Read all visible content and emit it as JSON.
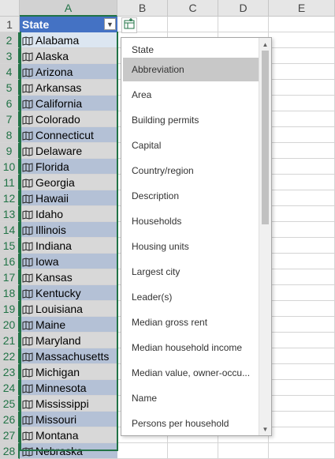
{
  "columns": [
    "A",
    "B",
    "C",
    "D",
    "E"
  ],
  "rows": [
    "1",
    "2",
    "3",
    "4",
    "5",
    "6",
    "7",
    "8",
    "9",
    "10",
    "11",
    "12",
    "13",
    "14",
    "15",
    "16",
    "17",
    "18",
    "19",
    "20",
    "21",
    "22",
    "23",
    "24",
    "25",
    "26",
    "27",
    "28"
  ],
  "header_cell": "State",
  "states": [
    "Alabama",
    "Alaska",
    "Arizona",
    "Arkansas",
    "California",
    "Colorado",
    "Connecticut",
    "Delaware",
    "Florida",
    "Georgia",
    "Hawaii",
    "Idaho",
    "Illinois",
    "Indiana",
    "Iowa",
    "Kansas",
    "Kentucky",
    "Louisiana",
    "Maine",
    "Maryland",
    "Massachusetts",
    "Michigan",
    "Minnesota",
    "Mississippi",
    "Missouri",
    "Montana",
    "Nebraska"
  ],
  "dropdown": {
    "title": "State",
    "items": [
      "Abbreviation",
      "Area",
      "Building permits",
      "Capital",
      "Country/region",
      "Description",
      "Households",
      "Housing units",
      "Largest city",
      "Leader(s)",
      "Median gross rent",
      "Median household income",
      "Median value, owner-occu...",
      "Name",
      "Persons per household"
    ],
    "highlighted_index": 0
  },
  "icons": {
    "filter": "dropdown-arrow-icon",
    "insert_data": "insert-data-icon",
    "geography": "map-icon"
  },
  "colors": {
    "header_fill": "#4472c4",
    "band_odd": "#b4c1d6",
    "band_even": "#d8d8d8",
    "selection": "#217346",
    "active_cell": "#dce6f1",
    "highlight": "#c8c8c8"
  }
}
